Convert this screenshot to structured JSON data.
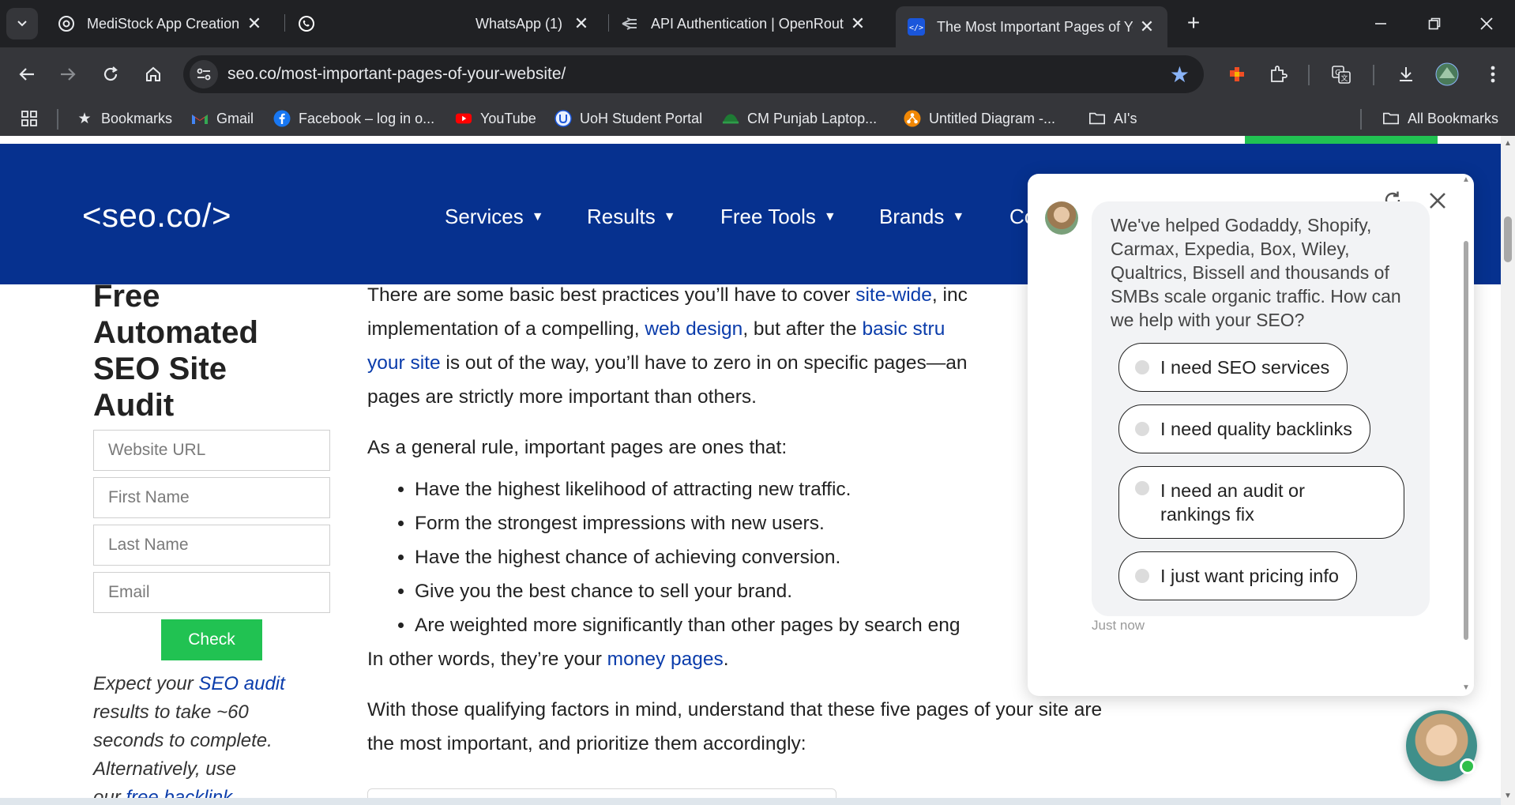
{
  "browser": {
    "tabs": [
      {
        "title": "MediStock App Creation",
        "icon": "openai-icon"
      },
      {
        "title": "WhatsApp (1)",
        "icon": "whatsapp-icon"
      },
      {
        "title": "API Authentication | OpenRoute",
        "icon": "openrouter-icon"
      },
      {
        "title": "The Most Important Pages of Yo",
        "icon": "code-icon",
        "active": true
      }
    ],
    "url": "seo.co/most-important-pages-of-your-website/",
    "bookmarks": [
      {
        "label": "Bookmarks",
        "icon": "star-icon"
      },
      {
        "label": "Gmail",
        "icon": "gmail-icon"
      },
      {
        "label": "Facebook – log in o...",
        "icon": "facebook-icon"
      },
      {
        "label": "YouTube",
        "icon": "youtube-icon"
      },
      {
        "label": "UoH Student Portal",
        "icon": "uoh-icon"
      },
      {
        "label": "CM Punjab Laptop...",
        "icon": "laptop-icon"
      },
      {
        "label": "Untitled Diagram -...",
        "icon": "diagram-icon"
      },
      {
        "label": "AI's",
        "icon": "folder-icon"
      }
    ],
    "all_bookmarks": "All Bookmarks"
  },
  "site": {
    "logo": "<seo.co/>",
    "nav": [
      "Services",
      "Results",
      "Free Tools",
      "Brands",
      "Co"
    ]
  },
  "sidebar": {
    "title": "Free Automated SEO Site Audit",
    "fields": [
      "Website URL",
      "First Name",
      "Last Name",
      "Email"
    ],
    "check": "Check",
    "note_before": "Expect your ",
    "note_link": "SEO audit",
    "note_after": " results to take ~60 seconds to complete. Alternatively, use",
    "note_tail_before": "our ",
    "note_tail_link": "free backlink"
  },
  "article": {
    "p1_a": "There are some basic best practices you’ll have to cover ",
    "p1_link1": "site-wide",
    "p1_b": ", inc",
    "p1_c": "implementation of a compelling, ",
    "p1_link2": "web design",
    "p1_d": ", but after the ",
    "p1_link3": "basic stru",
    "p1_link4": "your site",
    "p1_e": " is out of the way, you’ll have to zero in on specific pages—an",
    "p1_f": "pages are strictly more important than others.",
    "p2": "As a general rule, important pages are ones that:",
    "bullets": [
      "Have the highest likelihood of attracting new traffic.",
      "Form the strongest impressions with new users.",
      "Have the highest chance of achieving conversion.",
      "Give you the best chance to sell your brand.",
      "Are weighted more significantly than other pages by search eng"
    ],
    "p3_a": "In other words, they’re your ",
    "p3_link": "money pages",
    "p3_b": ".",
    "p4": "With those qualifying factors in mind, understand that these five pages of your site are the most important, and prioritize them accordingly:"
  },
  "chat": {
    "message": "We've helped Godaddy, Shopify, Carmax, Expedia, Box, Wiley, Qualtrics, Bissell and thousands of SMBs scale organic traffic. How can we help with your SEO?",
    "options": [
      "I need SEO services",
      "I need quality backlinks",
      "I need an audit or rankings fix",
      "I just want pricing info"
    ],
    "timestamp": "Just now"
  },
  "colors": {
    "site_header": "#06318f",
    "accent_green": "#21c252",
    "link": "#0a3cab",
    "chrome_dark": "#202124",
    "chrome_toolbar": "#35363a"
  }
}
